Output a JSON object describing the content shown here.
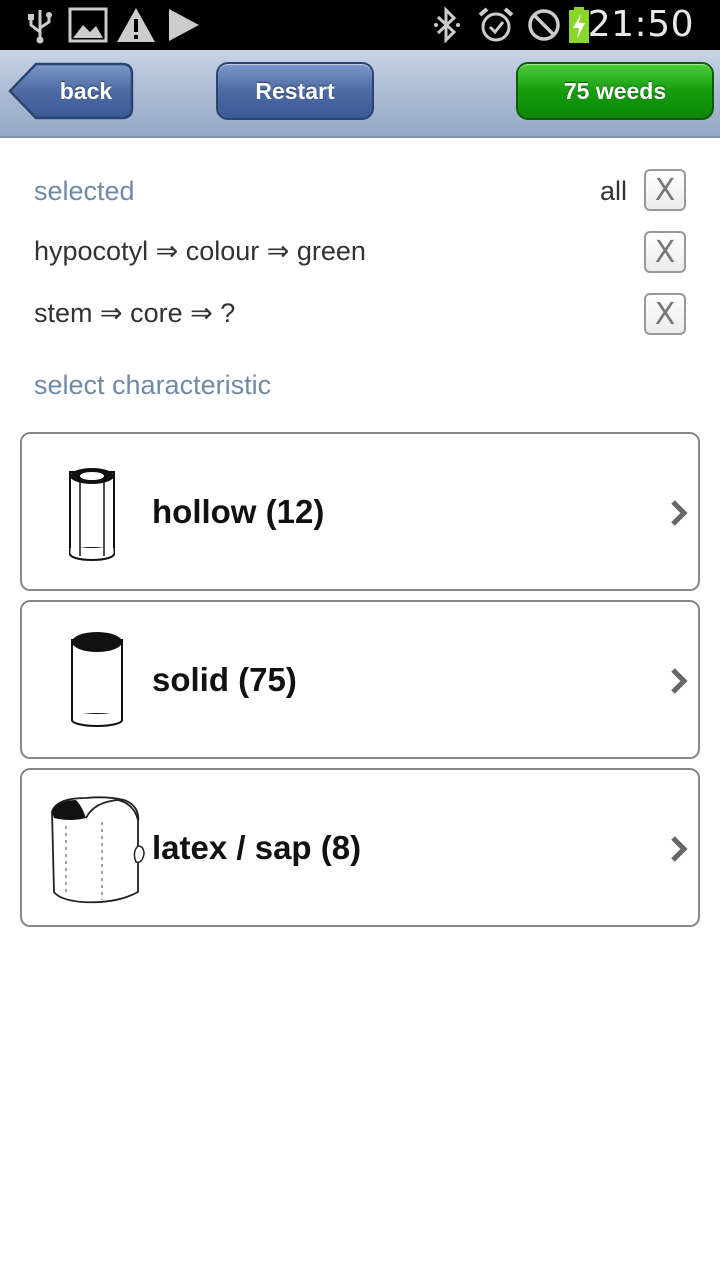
{
  "status_bar": {
    "time": "21:50",
    "left_icons": [
      "usb-icon",
      "gallery-icon",
      "warning-icon",
      "play-icon"
    ],
    "right_icons": [
      "bluetooth-icon",
      "alarm-icon",
      "do-not-disturb-icon",
      "battery-charging-icon"
    ]
  },
  "toolbar": {
    "back_label": "back",
    "restart_label": "Restart",
    "results_label": "75 weeds",
    "colors": {
      "blue": "#4c6aa4",
      "green": "#169c0e"
    }
  },
  "selected": {
    "heading": "selected",
    "clear_all_label": "all",
    "clear_icon": "X",
    "criteria": [
      {
        "text": "hypocotyl ⇒ colour ⇒ green"
      },
      {
        "text": "stem ⇒ core ⇒ ?"
      }
    ]
  },
  "characteristics": {
    "heading": "select characteristic",
    "options": [
      {
        "label": "hollow (12)",
        "icon": "hollow-stem-icon"
      },
      {
        "label": "solid (75)",
        "icon": "solid-stem-icon"
      },
      {
        "label": "latex / sap (8)",
        "icon": "latex-stem-icon"
      }
    ]
  }
}
